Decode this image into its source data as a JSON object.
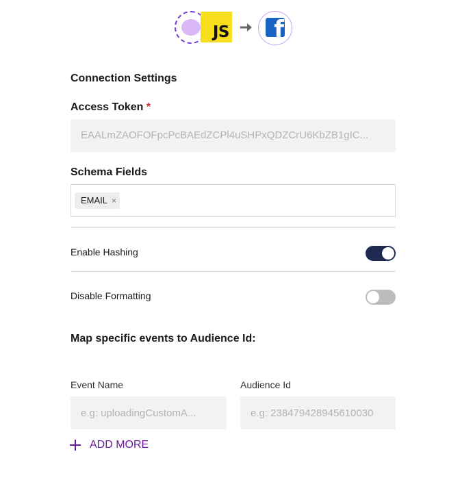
{
  "header": {
    "source_icon": "javascript-icon",
    "source_badge_text": "JS",
    "arrow_icon": "arrow-right-icon",
    "destination_icon": "facebook-icon",
    "destination_letter": "f"
  },
  "connection": {
    "title": "Connection Settings",
    "access_token_label": "Access Token",
    "required_mark": "*",
    "access_token_value": "EAALmZAOFOFpcPcBAEdZCPl4uSHPxQDZCrU6KbZB1gIC...",
    "schema_fields_label": "Schema Fields",
    "schema_tags": [
      {
        "label": "EMAIL",
        "remove_symbol": "×"
      }
    ]
  },
  "toggles": {
    "enable_hashing": {
      "label": "Enable Hashing",
      "state": "on"
    },
    "disable_formatting": {
      "label": "Disable Formatting",
      "state": "off"
    }
  },
  "mapping": {
    "title": "Map specific events to Audience Id:",
    "event_name_label": "Event Name",
    "event_name_placeholder": "e.g: uploadingCustomA...",
    "audience_id_label": "Audience Id",
    "audience_id_placeholder": "e.g: 238479428945610030",
    "add_more_label": "ADD MORE"
  },
  "colors": {
    "accent_purple": "#6a1b9a",
    "toggle_on": "#1e2a52",
    "toggle_off": "#bdbdbd",
    "required_red": "#d32f2f",
    "js_yellow": "#f7df1e",
    "facebook_blue": "#1a62c4"
  }
}
